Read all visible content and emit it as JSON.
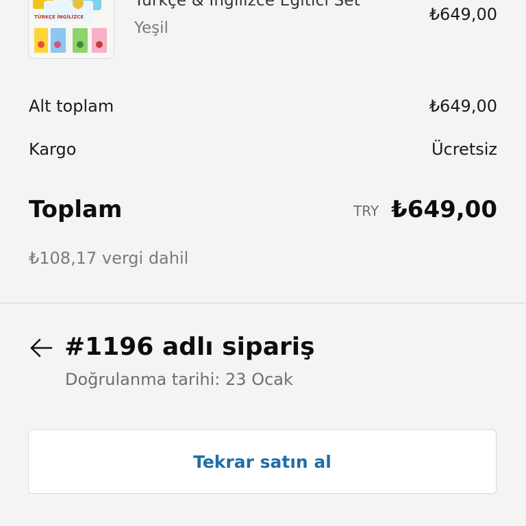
{
  "colors": {
    "background": "#f4f4f4",
    "accent": "#1f6fa6"
  },
  "product": {
    "name": "Türkçe & İngilizce Eğitici Set",
    "variant": "Yeşil",
    "price": "₺649,00",
    "thumb_text": "TÜRKÇE İNGİLİZCE"
  },
  "summary": {
    "subtotal_label": "Alt toplam",
    "subtotal_value": "₺649,00",
    "shipping_label": "Kargo",
    "shipping_value": "Ücretsiz",
    "total_label": "Toplam",
    "currency": "TRY",
    "total_value": "₺649,00",
    "tax_note": "₺108,17 vergi dahil"
  },
  "order": {
    "title": "#1196 adlı sipariş",
    "confirmed": "Doğrulanma tarihi: 23 Ocak",
    "back_icon": "arrow-left-icon"
  },
  "actions": {
    "rebuy_label": "Tekrar satın al"
  }
}
